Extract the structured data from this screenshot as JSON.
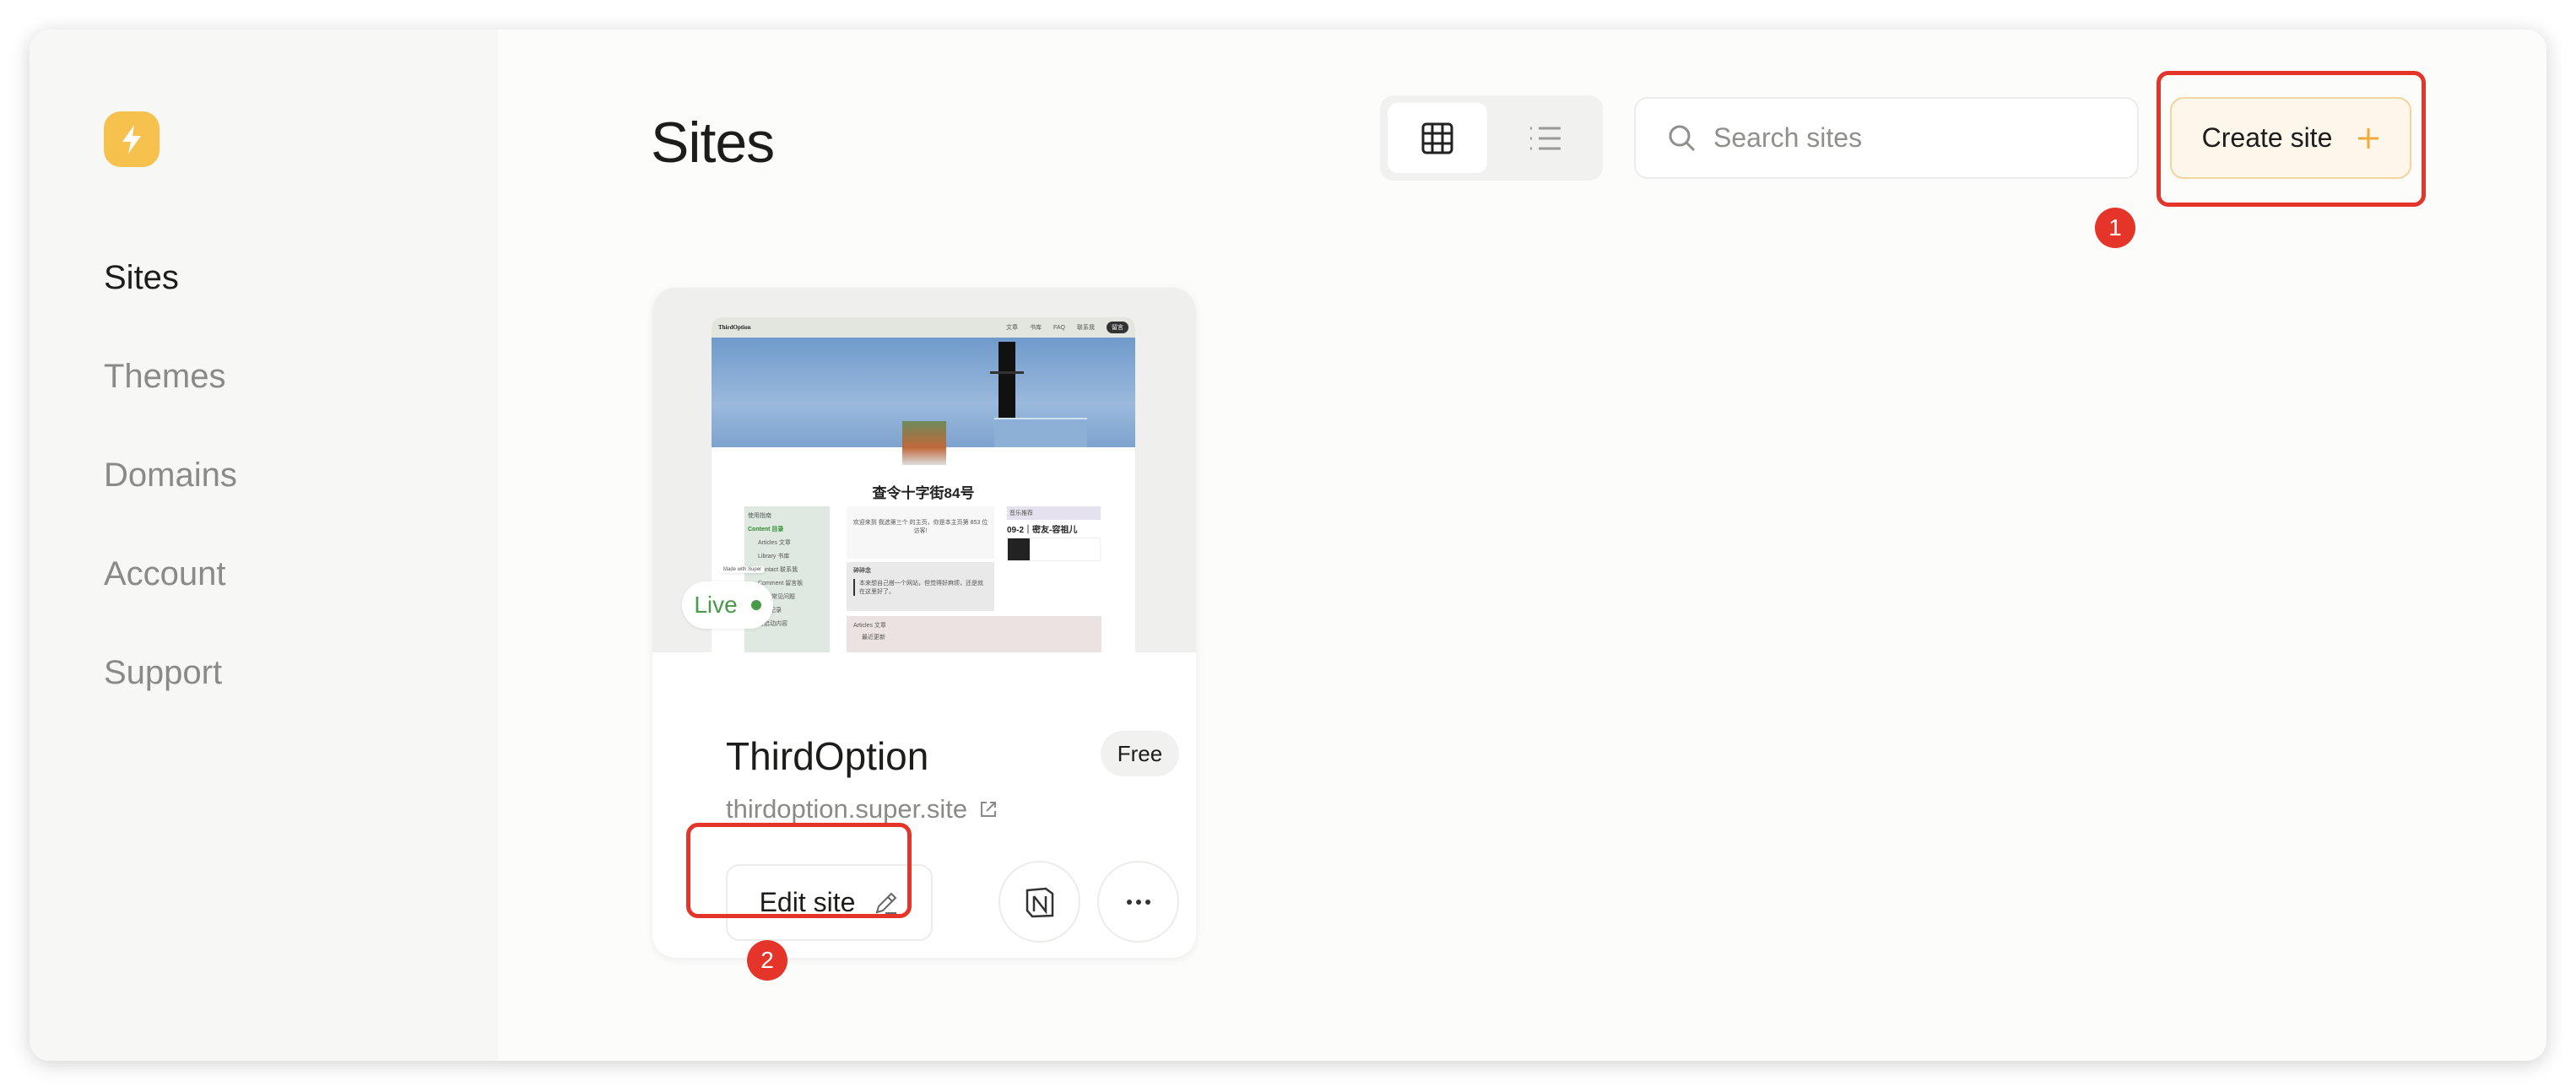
{
  "sidebar": {
    "logo": "bolt-icon",
    "items": [
      {
        "label": "Sites",
        "active": true
      },
      {
        "label": "Themes"
      },
      {
        "label": "Domains"
      },
      {
        "label": "Account"
      },
      {
        "label": "Support"
      }
    ]
  },
  "header": {
    "title": "Sites",
    "view_modes": [
      "grid-icon",
      "list-icon"
    ],
    "active_view": "grid",
    "search_placeholder": "Search sites",
    "create_label": "Create site",
    "create_icon": "plus-icon"
  },
  "annotations": [
    "1",
    "2"
  ],
  "site": {
    "name": "ThirdOption",
    "plan": "Free",
    "url": "thirdoption.super.site",
    "status": "Live",
    "status_color": "#4a9a4a",
    "edit_label": "Edit site",
    "preview": {
      "brand": "ThirdOption",
      "nav": [
        "文章",
        "书库",
        "FAQ",
        "联系我",
        "留言"
      ],
      "heading": "查令十字街84号",
      "toc_title": "使用指南",
      "toc_heading": "Content 目录",
      "toc_items": [
        "Articles 文章",
        "Library 书库",
        "Contact 联系我",
        "Comment 留言板",
        "FAQ 常见问题",
        "更新记录",
        "待启动内容"
      ],
      "made_with": "Made with Super",
      "welcome": "欢迎来到 我选第三个 的主页，你是本主页第 853 位访客!",
      "quote_title": "碎碎念",
      "quote": "本来想自己搭一个网站，但觉得好麻烦，还是就在这里好了。",
      "music_title": "音乐推荐",
      "song": "09-2｜密友-容祖儿",
      "articles_title": "Articles 文章",
      "articles_sort": "最近更新"
    }
  },
  "colors": {
    "accent": "#f6c14d",
    "annotation": "#e5352a"
  }
}
